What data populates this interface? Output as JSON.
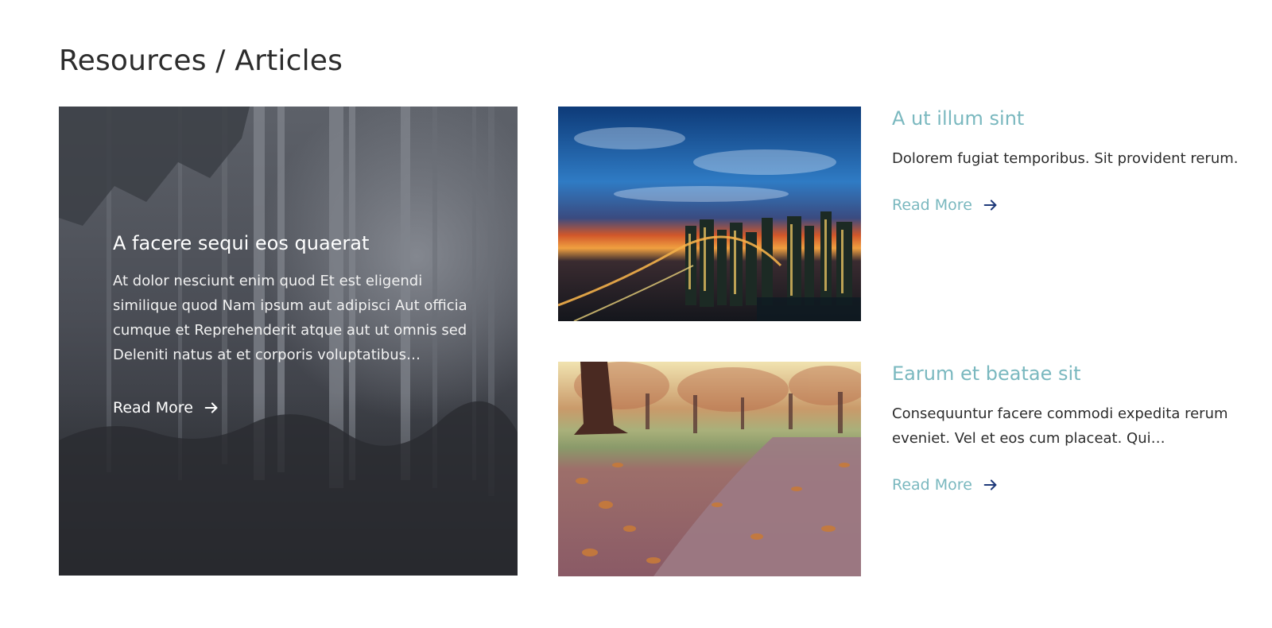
{
  "page": {
    "title": "Resources / Articles"
  },
  "featured": {
    "title": "A facere sequi eos quaerat",
    "excerpt": "At dolor nesciunt enim quod Et est eligendi similique quod Nam ipsum aut adipisci Aut officia cumque et Reprehenderit atque aut ut omnis sed Deleniti natus at et corporis voluptatibus…",
    "read_more": "Read More",
    "image": "forest-image"
  },
  "articles": [
    {
      "title": "A ut illum sint",
      "excerpt": "Dolorem fugiat temporibus. Sit provident rerum.",
      "read_more": "Read More",
      "image": "city-skyline-image"
    },
    {
      "title": "Earum et beatae sit",
      "excerpt": "Consequuntur facere commodi expedita rerum eveniet. Vel et eos cum placeat. Qui…",
      "read_more": "Read More",
      "image": "autumn-path-image"
    }
  ],
  "colors": {
    "accent": "#7ab8bf",
    "arrow": "#1f3a7a",
    "heading": "#2c2c2c"
  }
}
